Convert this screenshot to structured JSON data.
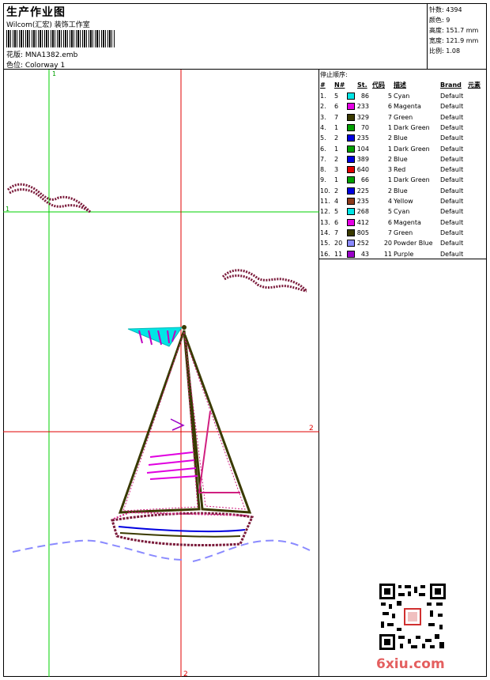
{
  "header": {
    "title": "生产作业图",
    "company": "Wilcom(汇宏) 装饰工作室",
    "design_line": "花版:  MNA1382.emb",
    "colorway_line": "色位:  Colorway 1"
  },
  "stats": [
    {
      "label": "针数:",
      "value": "4394"
    },
    {
      "label": "颜色:",
      "value": "9"
    },
    {
      "label": "高度:",
      "value": "151.7 mm"
    },
    {
      "label": "宽度:",
      "value": "121.9 mm"
    },
    {
      "label": "比例:",
      "value": "1.08"
    }
  ],
  "canvas": {
    "labels": [
      "1",
      "1",
      "2",
      "2"
    ]
  },
  "stop_sequence": {
    "title": "停止顺序:",
    "columns": [
      "#",
      "N#",
      "St.",
      "代码",
      "描述",
      "Brand",
      "元素"
    ],
    "rows": [
      {
        "idx": "1.",
        "n": "5",
        "color": "#00e5e5",
        "st": "86",
        "code": "5",
        "desc": "Cyan",
        "brand": "Default"
      },
      {
        "idx": "2.",
        "n": "6",
        "color": "#e500e5",
        "st": "233",
        "code": "6",
        "desc": "Magenta",
        "brand": "Default"
      },
      {
        "idx": "3.",
        "n": "7",
        "color": "#3a3a00",
        "st": "329",
        "code": "7",
        "desc": "Green",
        "brand": "Default"
      },
      {
        "idx": "4.",
        "n": "1",
        "color": "#00a000",
        "st": "70",
        "code": "1",
        "desc": "Dark Green",
        "brand": "Default"
      },
      {
        "idx": "5.",
        "n": "2",
        "color": "#0000e0",
        "st": "235",
        "code": "2",
        "desc": "Blue",
        "brand": "Default"
      },
      {
        "idx": "6.",
        "n": "1",
        "color": "#00a000",
        "st": "104",
        "code": "1",
        "desc": "Dark Green",
        "brand": "Default"
      },
      {
        "idx": "7.",
        "n": "2",
        "color": "#0000e0",
        "st": "389",
        "code": "2",
        "desc": "Blue",
        "brand": "Default"
      },
      {
        "idx": "8.",
        "n": "3",
        "color": "#e00000",
        "st": "640",
        "code": "3",
        "desc": "Red",
        "brand": "Default"
      },
      {
        "idx": "9.",
        "n": "1",
        "color": "#00a000",
        "st": "66",
        "code": "1",
        "desc": "Dark Green",
        "brand": "Default"
      },
      {
        "idx": "10.",
        "n": "2",
        "color": "#0000e0",
        "st": "225",
        "code": "2",
        "desc": "Blue",
        "brand": "Default"
      },
      {
        "idx": "11.",
        "n": "4",
        "color": "#8b3a1a",
        "st": "235",
        "code": "4",
        "desc": "Yellow",
        "brand": "Default"
      },
      {
        "idx": "12.",
        "n": "5",
        "color": "#00e5e5",
        "st": "268",
        "code": "5",
        "desc": "Cyan",
        "brand": "Default"
      },
      {
        "idx": "13.",
        "n": "6",
        "color": "#e500e5",
        "st": "412",
        "code": "6",
        "desc": "Magenta",
        "brand": "Default"
      },
      {
        "idx": "14.",
        "n": "7",
        "color": "#3a3a00",
        "st": "805",
        "code": "7",
        "desc": "Green",
        "brand": "Default"
      },
      {
        "idx": "15.",
        "n": "20",
        "color": "#8a8aff",
        "st": "252",
        "code": "20",
        "desc": "Powder Blue",
        "brand": "Default"
      },
      {
        "idx": "16.",
        "n": "11",
        "color": "#9a00c8",
        "st": "43",
        "code": "11",
        "desc": "Purple",
        "brand": "Default"
      }
    ]
  },
  "watermark": "6xiu.com"
}
